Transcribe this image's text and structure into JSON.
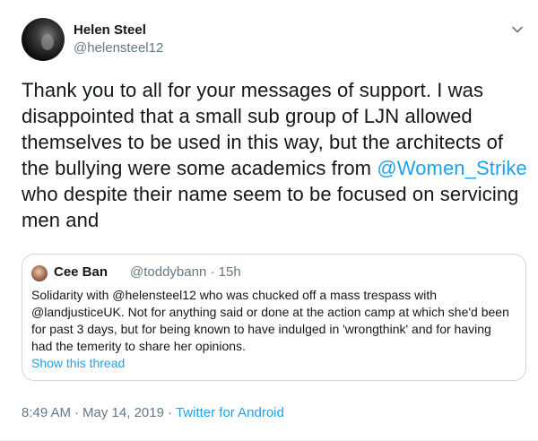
{
  "author": {
    "name": "Helen Steel",
    "handle": "@helensteel12"
  },
  "tweet": {
    "text_before": "Thank you to all for your messages of support. I was disappointed that a small sub group of LJN allowed themselves to be used in this way, but the architects of the bullying were some academics from ",
    "mention": "@Women_Strike",
    "text_after": " who despite their name seem to be focused on servicing men and"
  },
  "quoted": {
    "name": "Cee Ban",
    "handle": "@toddybann",
    "separator": "·",
    "time": "15h",
    "text": "Solidarity with @helensteel12 who was chucked off a mass trespass with @landjusticeUK. Not for anything said or done at the action camp at which she'd been for past 3 days, but for being known to have indulged in 'wrongthink' and for having had the temerity to share her opinions.",
    "show_thread": "Show this thread"
  },
  "footer": {
    "time": "8:49 AM",
    "separator": "·",
    "date": "May 14, 2019",
    "separator2": "·",
    "source": "Twitter for Android"
  },
  "icons": {
    "caret": "chevron-down-icon"
  },
  "colors": {
    "link": "#1da1f2",
    "secondary_text": "#657786",
    "border": "#ccd6dd"
  }
}
